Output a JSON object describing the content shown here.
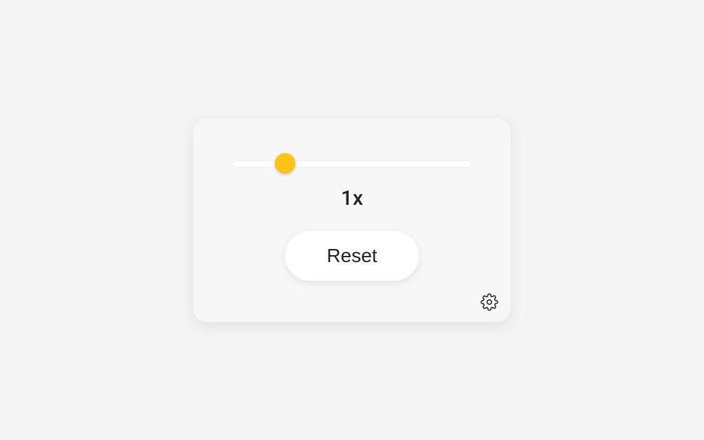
{
  "slider": {
    "position_percent": 22
  },
  "value_label": "1x",
  "reset_label": "Reset",
  "colors": {
    "thumb": "#fcc419",
    "card_bg": "#f7f7f7",
    "page_bg": "#f4f4f4"
  }
}
